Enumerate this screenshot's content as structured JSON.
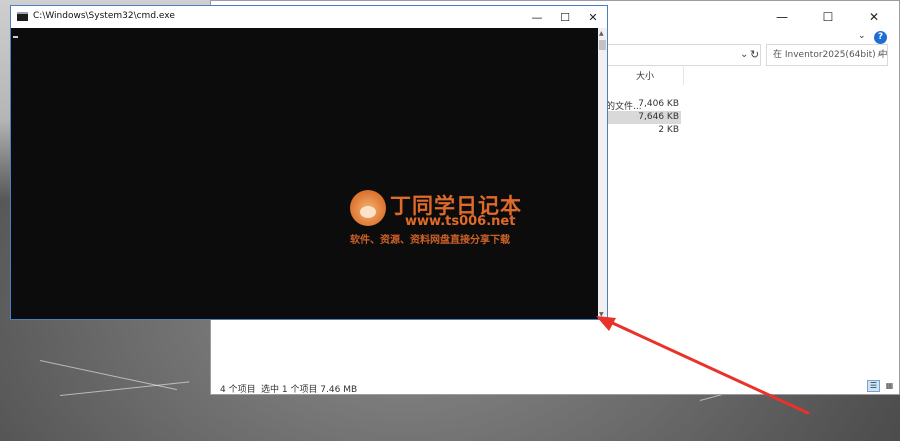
{
  "cmd": {
    "title": "C:\\Windows\\System32\\cmd.exe",
    "minimize": "—",
    "maximize": "☐",
    "close": "✕"
  },
  "explorer": {
    "minimize": "—",
    "maximize": "☐",
    "close": "✕",
    "search_placeholder": "在 Inventor2025(64bit) 中搜...",
    "column_size": "大小",
    "files": [
      {
        "name": "的文件...",
        "size": "7,406 KB",
        "selected": false
      },
      {
        "name": "",
        "size": "7,646 KB",
        "selected": true
      },
      {
        "name": "",
        "size": "2 KB",
        "selected": false
      }
    ],
    "status_count": "4 个项目",
    "status_selected": "选中 1 个项目  7.46 MB"
  },
  "watermark": {
    "title": "丁同学日记本",
    "url": "www.ts006.net",
    "subtitle": "软件、资源、资料网盘直接分享下载"
  },
  "colors": {
    "arrow": "#e8322a",
    "cmd_bg": "#0c0c0c",
    "watermark": "#e06a2a"
  }
}
